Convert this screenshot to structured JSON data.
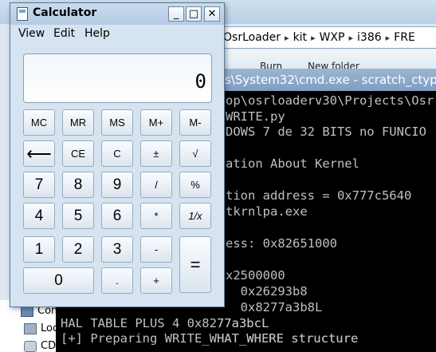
{
  "explorer": {
    "address": [
      "OsrLoader",
      "kit",
      "WXP",
      "i386",
      "FRE"
    ],
    "toolbar": [
      "Burn",
      "New folder"
    ],
    "nav": [
      "Com",
      "Loc",
      "CD"
    ]
  },
  "cmd": {
    "title": "s\\System32\\cmd.exe - scratch_ctypes",
    "lines": [
      "op\\osrloaderv30\\Projects\\Osr",
      "WRITE.py",
      "DOWS 7 de 32 BITS no FUNCIO",
      "",
      "ation About Kernel",
      "",
      "tion address = 0x777c5640",
      "tkrnlpa.exe",
      "",
      "ess: 0x82651000",
      "",
      "x2500000",
      "  0x26293b8",
      "  0x8277a3b8L",
      "HAL TABLE PLUS 4 0x8277a3bcL",
      "[+] Preparing WRITE_WHAT_WHERE structure"
    ]
  },
  "calculator": {
    "title": "Calculator",
    "window_buttons": {
      "minimize": "_",
      "maximize": "□",
      "close": "✕"
    },
    "menu": [
      "View",
      "Edit",
      "Help"
    ],
    "display": "0",
    "buttons": {
      "mc": "MC",
      "mr": "MR",
      "ms": "MS",
      "mplus": "M+",
      "mminus": "M-",
      "back": "⟵",
      "ce": "CE",
      "c": "C",
      "plusminus": "±",
      "sqrt": "√",
      "seven": "7",
      "eight": "8",
      "nine": "9",
      "divide": "/",
      "percent": "%",
      "four": "4",
      "five": "5",
      "six": "6",
      "multiply": "*",
      "reciprocal": "1/x",
      "one": "1",
      "two": "2",
      "three": "3",
      "minus": "-",
      "equals": "=",
      "zero": "0",
      "decimal": ".",
      "plus": "+"
    }
  }
}
